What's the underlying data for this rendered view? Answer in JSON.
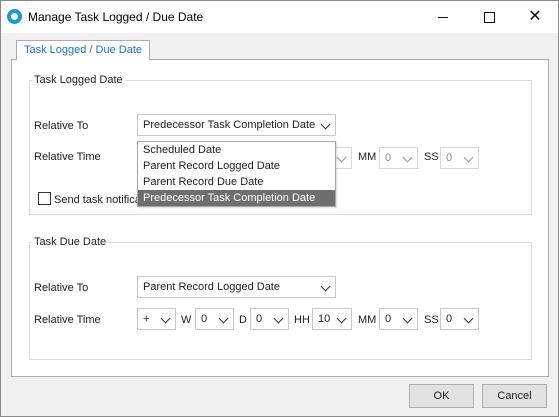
{
  "window": {
    "title": "Manage Task Logged / Due Date",
    "close_glyph": "✕"
  },
  "tab": {
    "label": "Task Logged / Due Date"
  },
  "logged": {
    "group_title": "Task Logged Date",
    "relative_to_label": "Relative To",
    "relative_to_value": "Predecessor Task Completion Date",
    "relative_time_label": "Relative Time",
    "mm_label": "MM",
    "mm_value": "0",
    "ss_label": "SS",
    "ss_value": "0",
    "send_notification_label": "Send task notifica",
    "send_notification_checked": false,
    "dropdown_options": [
      "Scheduled Date",
      "Parent Record Logged Date",
      "Parent Record Due Date",
      "Predecessor Task Completion Date"
    ],
    "dropdown_selected_index": 3
  },
  "due": {
    "group_title": "Task Due Date",
    "relative_to_label": "Relative To",
    "relative_to_value": "Parent Record Logged Date",
    "relative_time_label": "Relative Time",
    "sign_value": "+",
    "w_label": "W",
    "w_value": "0",
    "d_label": "D",
    "d_value": "0",
    "hh_label": "HH",
    "hh_value": "10",
    "mm_label": "MM",
    "mm_value": "0",
    "ss_label": "SS",
    "ss_value": "0"
  },
  "buttons": {
    "ok": "OK",
    "cancel": "Cancel"
  }
}
